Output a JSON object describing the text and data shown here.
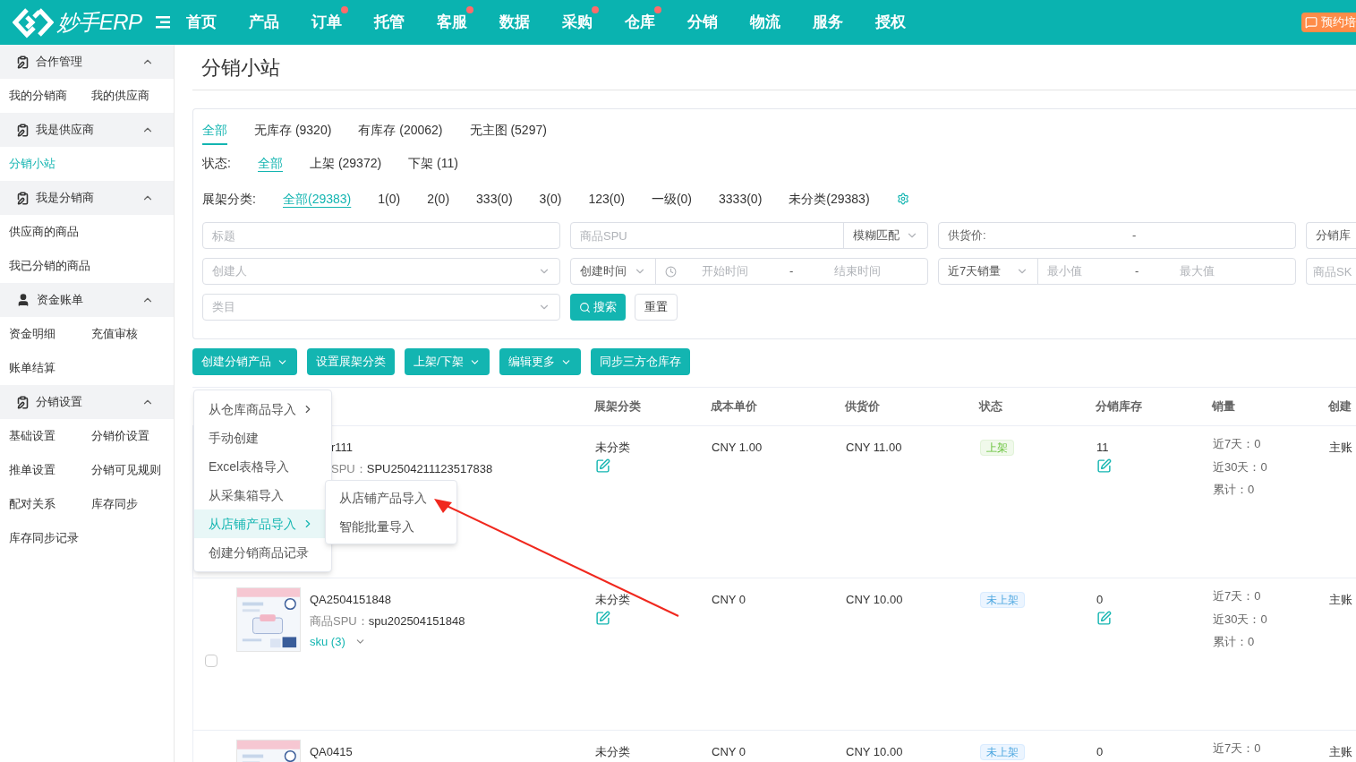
{
  "topbar": {
    "logo": "妙手ERP",
    "nav": [
      {
        "label": "首页",
        "badge": false
      },
      {
        "label": "产品",
        "badge": false
      },
      {
        "label": "订单",
        "badge": true
      },
      {
        "label": "托管",
        "badge": false
      },
      {
        "label": "客服",
        "badge": true
      },
      {
        "label": "数据",
        "badge": false
      },
      {
        "label": "采购",
        "badge": true
      },
      {
        "label": "仓库",
        "badge": true
      },
      {
        "label": "分销",
        "badge": false
      },
      {
        "label": "物流",
        "badge": false
      },
      {
        "label": "服务",
        "badge": false
      },
      {
        "label": "授权",
        "badge": false
      }
    ],
    "promo": "预约培"
  },
  "sidebar": {
    "groups": [
      {
        "title": "合作管理",
        "expanded": true,
        "rows": [
          [
            {
              "label": "我的分销商",
              "selected": false
            },
            {
              "label": "我的供应商",
              "selected": false
            }
          ]
        ]
      },
      {
        "title": "我是供应商",
        "expanded": true,
        "rows": [
          [
            {
              "label": "分销小站",
              "selected": true
            }
          ]
        ]
      },
      {
        "title": "我是分销商",
        "expanded": true,
        "rows": [
          [
            {
              "label": "供应商的商品",
              "selected": false
            }
          ],
          [
            {
              "label": "我已分销的商品",
              "selected": false
            }
          ]
        ]
      },
      {
        "title": "资金账单",
        "expanded": true,
        "rows": [
          [
            {
              "label": "资金明细",
              "selected": false
            },
            {
              "label": "充值审核",
              "selected": false
            }
          ],
          [
            {
              "label": "账单结算",
              "selected": false
            }
          ]
        ]
      },
      {
        "title": "分销设置",
        "expanded": true,
        "rows": [
          [
            {
              "label": "基础设置",
              "selected": false
            },
            {
              "label": "分销价设置",
              "selected": false
            }
          ],
          [
            {
              "label": "推单设置",
              "selected": false
            },
            {
              "label": "分销可见规则",
              "selected": false
            }
          ],
          [
            {
              "label": "配对关系",
              "selected": false
            },
            {
              "label": "库存同步",
              "selected": false
            }
          ],
          [
            {
              "label": "库存同步记录",
              "selected": false
            }
          ]
        ]
      }
    ]
  },
  "page_title": "分销小站",
  "filters": {
    "stock_tabs": [
      {
        "label": "全部",
        "selected": true
      },
      {
        "label": "无库存 (9320)",
        "selected": false
      },
      {
        "label": "有库存 (20062)",
        "selected": false
      },
      {
        "label": "无主图 (5297)",
        "selected": false
      }
    ],
    "status": {
      "label": "状态:",
      "options": [
        {
          "label": "全部",
          "selected": true
        },
        {
          "label": "上架 (29372)",
          "selected": false
        },
        {
          "label": "下架 (11)",
          "selected": false
        }
      ]
    },
    "shelf": {
      "label": "展架分类:",
      "options": [
        {
          "label": "全部(29383)",
          "selected": true
        },
        {
          "label": "1(0)",
          "selected": false
        },
        {
          "label": "2(0)",
          "selected": false
        },
        {
          "label": "333(0)",
          "selected": false
        },
        {
          "label": "3(0)",
          "selected": false
        },
        {
          "label": "123(0)",
          "selected": false
        },
        {
          "label": "一级(0)",
          "selected": false
        },
        {
          "label": "3333(0)",
          "selected": false
        },
        {
          "label": "未分类(29383)",
          "selected": false
        }
      ]
    },
    "fields": [
      [
        {
          "kind": "text",
          "placeholder": "标题"
        },
        {
          "kind": "text_select",
          "placeholder": "商品SPU",
          "value": "模糊匹配"
        },
        {
          "kind": "range",
          "label": "供货价:",
          "separator": "-"
        },
        {
          "kind": "value",
          "value": "分销库"
        }
      ],
      [
        {
          "kind": "select",
          "placeholder": "创建人"
        },
        {
          "kind": "date_range",
          "value": "创建时间",
          "from": "开始时间",
          "separator": "-",
          "to": "结束时间"
        },
        {
          "kind": "select_range",
          "value": "近7天销量",
          "from": "最小值",
          "separator": "-",
          "to": "最大值"
        },
        {
          "kind": "text",
          "placeholder": "商品SK"
        }
      ],
      [
        {
          "kind": "select",
          "placeholder": "类目"
        },
        {
          "kind": "buttons",
          "search": "搜索",
          "reset": "重置"
        }
      ]
    ]
  },
  "toolbar": [
    {
      "label": "创建分销产品",
      "caret": true
    },
    {
      "label": "设置展架分类",
      "caret": false
    },
    {
      "label": "上架/下架",
      "caret": true
    },
    {
      "label": "编辑更多",
      "caret": true
    },
    {
      "label": "同步三方仓库存",
      "caret": false
    }
  ],
  "create_menu": {
    "items": [
      {
        "label": "从仓库商品导入",
        "submenu": true,
        "selected": false
      },
      {
        "label": "手动创建",
        "submenu": false,
        "selected": false
      },
      {
        "label": "Excel表格导入",
        "submenu": false,
        "selected": false
      },
      {
        "label": "从采集箱导入",
        "submenu": false,
        "selected": false
      },
      {
        "label": "从店铺产品导入",
        "submenu": true,
        "selected": true
      },
      {
        "label": "创建分销商品记录",
        "submenu": false,
        "selected": false
      }
    ],
    "submenu": [
      "从店铺产品导入",
      "智能批量导入"
    ]
  },
  "table": {
    "columns": [
      "展架分类",
      "成本单价",
      "供货价",
      "状态",
      "分销库存",
      "销量",
      "创建"
    ],
    "rows": [
      {
        "thumbnail": false,
        "title": "r111",
        "spu_label": "SPU：",
        "spu": "SPU2504211123517838",
        "category": "未分类",
        "editable": true,
        "cost": "CNY 1.00",
        "price": "CNY 11.00",
        "status": {
          "label": "上架",
          "kind": "listed"
        },
        "stock": "11",
        "sales": [
          "近7天：0",
          "近30天：0",
          "累计：0"
        ],
        "creator": "主账"
      },
      {
        "thumbnail": true,
        "checked": false,
        "title": "QA2504151848",
        "spu_label": "商品SPU：",
        "spu": "spu202504151848",
        "sku": "sku (3)",
        "category": "未分类",
        "editable": true,
        "cost": "CNY 0",
        "price": "CNY 10.00",
        "status": {
          "label": "未上架",
          "kind": "unlisted"
        },
        "stock": "0",
        "sales": [
          "近7天：0",
          "近30天：0",
          "累计：0"
        ],
        "creator": "主账"
      },
      {
        "thumbnail": true,
        "title": "QA0415",
        "category": "未分类",
        "editable": false,
        "cost": "CNY 0",
        "price": "CNY 10.00",
        "status": {
          "label": "未上架",
          "kind": "unlisted"
        },
        "stock": "0",
        "sales": [
          "近7天：0"
        ],
        "creator": "主账"
      }
    ]
  }
}
